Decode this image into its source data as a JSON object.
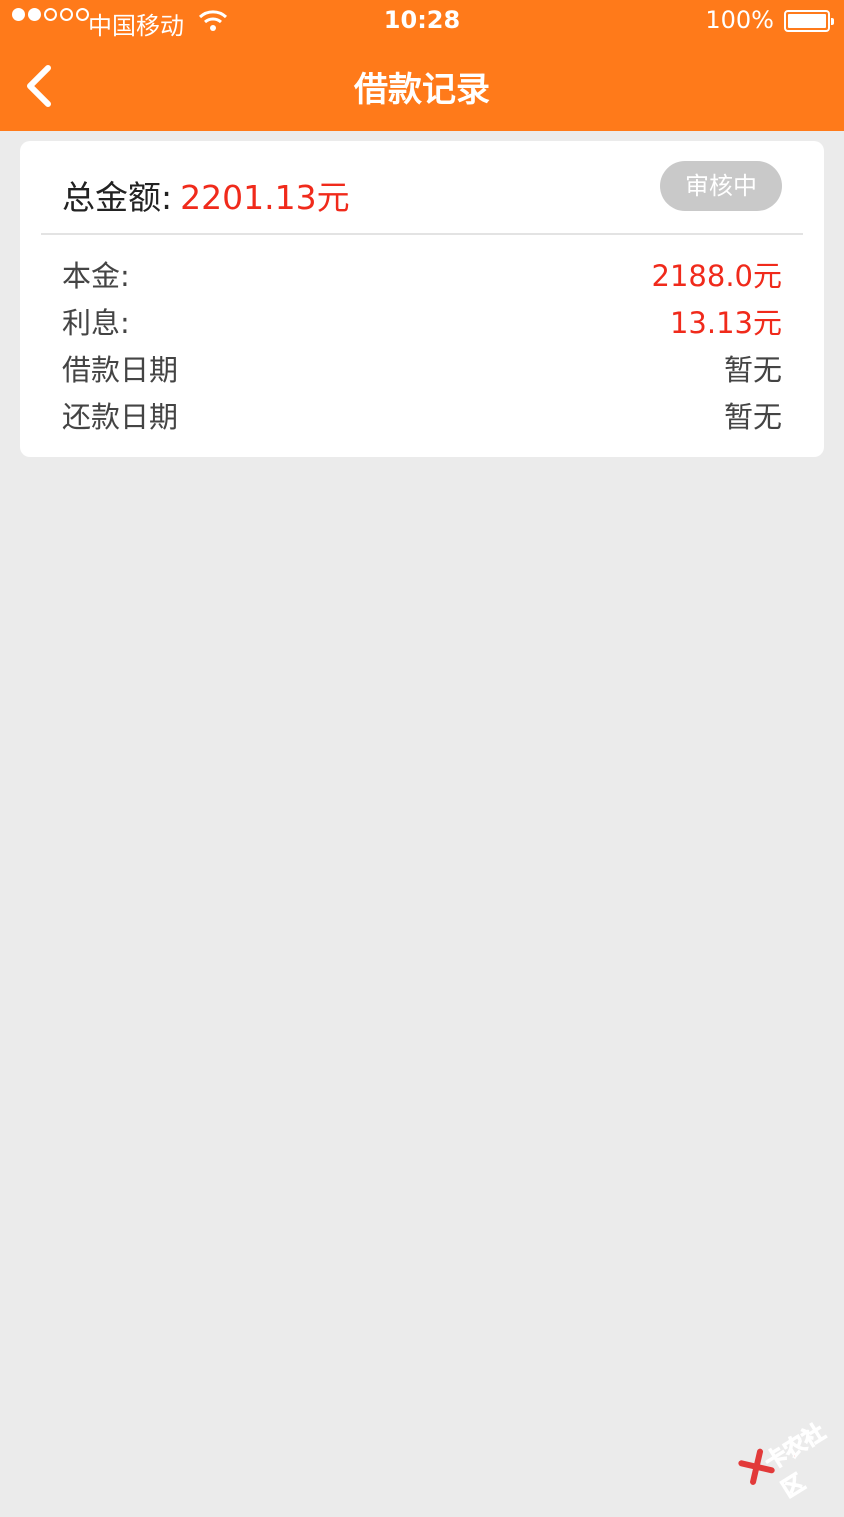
{
  "status_bar": {
    "carrier": "中国移动",
    "time": "10:28",
    "battery": "100%"
  },
  "nav": {
    "title": "借款记录"
  },
  "record": {
    "total_label": "总金额:",
    "total_value": "2201.13元",
    "status": "审核中",
    "details": [
      {
        "label": "本金:",
        "value": "2188.0元",
        "highlight": true
      },
      {
        "label": "利息:",
        "value": "13.13元",
        "highlight": true
      },
      {
        "label": "借款日期",
        "value": "暂无",
        "highlight": false
      },
      {
        "label": "还款日期",
        "value": "暂无",
        "highlight": false
      }
    ]
  },
  "watermark": {
    "text": "卡农社区"
  },
  "colors": {
    "header": "#ff7a1a",
    "amount": "#f02a1b",
    "badge": "#c9c9c9",
    "background": "#ebebeb"
  },
  "icons": [
    "signal-icon",
    "wifi-icon",
    "battery-icon",
    "back-arrow-icon"
  ]
}
